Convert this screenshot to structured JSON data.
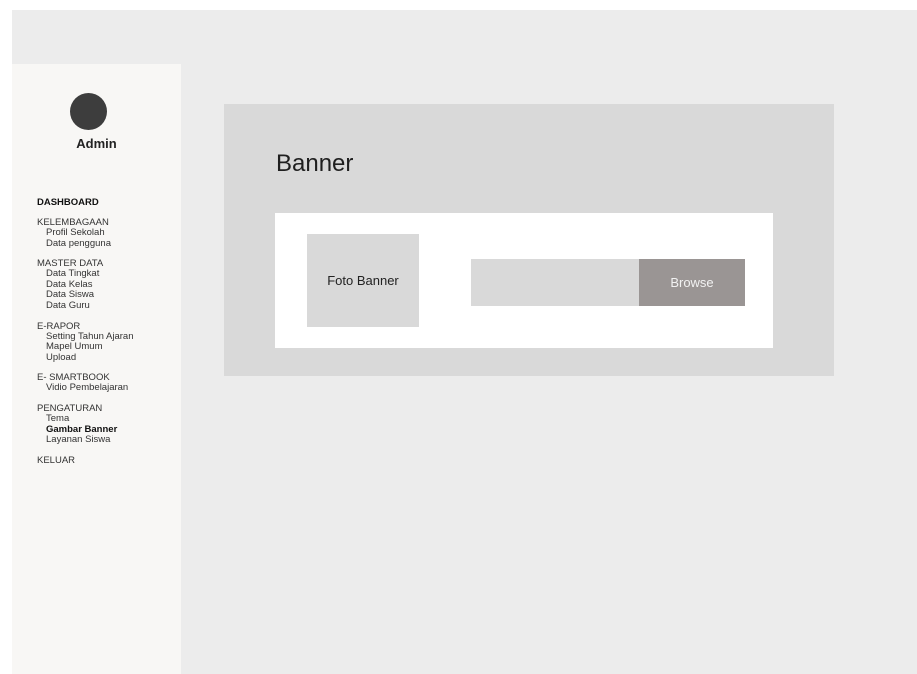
{
  "user": {
    "name": "Admin"
  },
  "nav": {
    "dashboard": "DASHBOARD",
    "groups": [
      {
        "title": "KELEMBAGAAN",
        "items": [
          "Profil Sekolah",
          "Data pengguna"
        ]
      },
      {
        "title": "MASTER DATA",
        "items": [
          "Data Tingkat",
          "Data Kelas",
          "Data Siswa",
          "Data Guru"
        ]
      },
      {
        "title": "E-RAPOR",
        "items": [
          "Setting Tahun Ajaran",
          "Mapel Umum",
          "Upload"
        ]
      },
      {
        "title": "E- SMARTBOOK",
        "items": [
          "Vidio Pembelajaran"
        ]
      },
      {
        "title": "PENGATURAN",
        "items": [
          "Tema",
          "Gambar Banner",
          "Layanan Siswa"
        ]
      }
    ],
    "logout": "KELUAR",
    "active_item": "Gambar Banner"
  },
  "main": {
    "title": "Banner",
    "photo_label": "Foto Banner",
    "browse_label": "Browse"
  },
  "colors": {
    "avatar": "#3d3d3d",
    "browse_button": "#9a9594"
  }
}
